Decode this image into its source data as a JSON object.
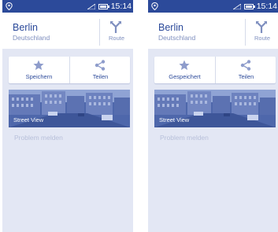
{
  "colors": {
    "primary": "#2c4a9a",
    "background": "#e3e7f4",
    "muted_text": "#7f8fbf",
    "disabled_text": "#b8c0da"
  },
  "screens": [
    {
      "status": {
        "time": "15:14",
        "icons": [
          "location-icon",
          "signal-icon",
          "battery-icon"
        ]
      },
      "place": {
        "name": "Berlin",
        "country": "Deutschland"
      },
      "route": {
        "label": "Route",
        "icon": "route-icon"
      },
      "actions": [
        {
          "label": "Speichern",
          "icon": "star-icon"
        },
        {
          "label": "Teilen",
          "icon": "share-icon"
        }
      ],
      "street_view": {
        "label": "Street View"
      },
      "report_label": "Problem melden"
    },
    {
      "status": {
        "time": "15:14",
        "icons": [
          "location-icon",
          "signal-icon",
          "battery-icon"
        ]
      },
      "place": {
        "name": "Berlin",
        "country": "Deutschland"
      },
      "route": {
        "label": "Route",
        "icon": "route-icon"
      },
      "actions": [
        {
          "label": "Gespeichert",
          "icon": "star-icon"
        },
        {
          "label": "Teilen",
          "icon": "share-icon"
        }
      ],
      "street_view": {
        "label": "Street View"
      },
      "report_label": "Problem melden"
    }
  ]
}
